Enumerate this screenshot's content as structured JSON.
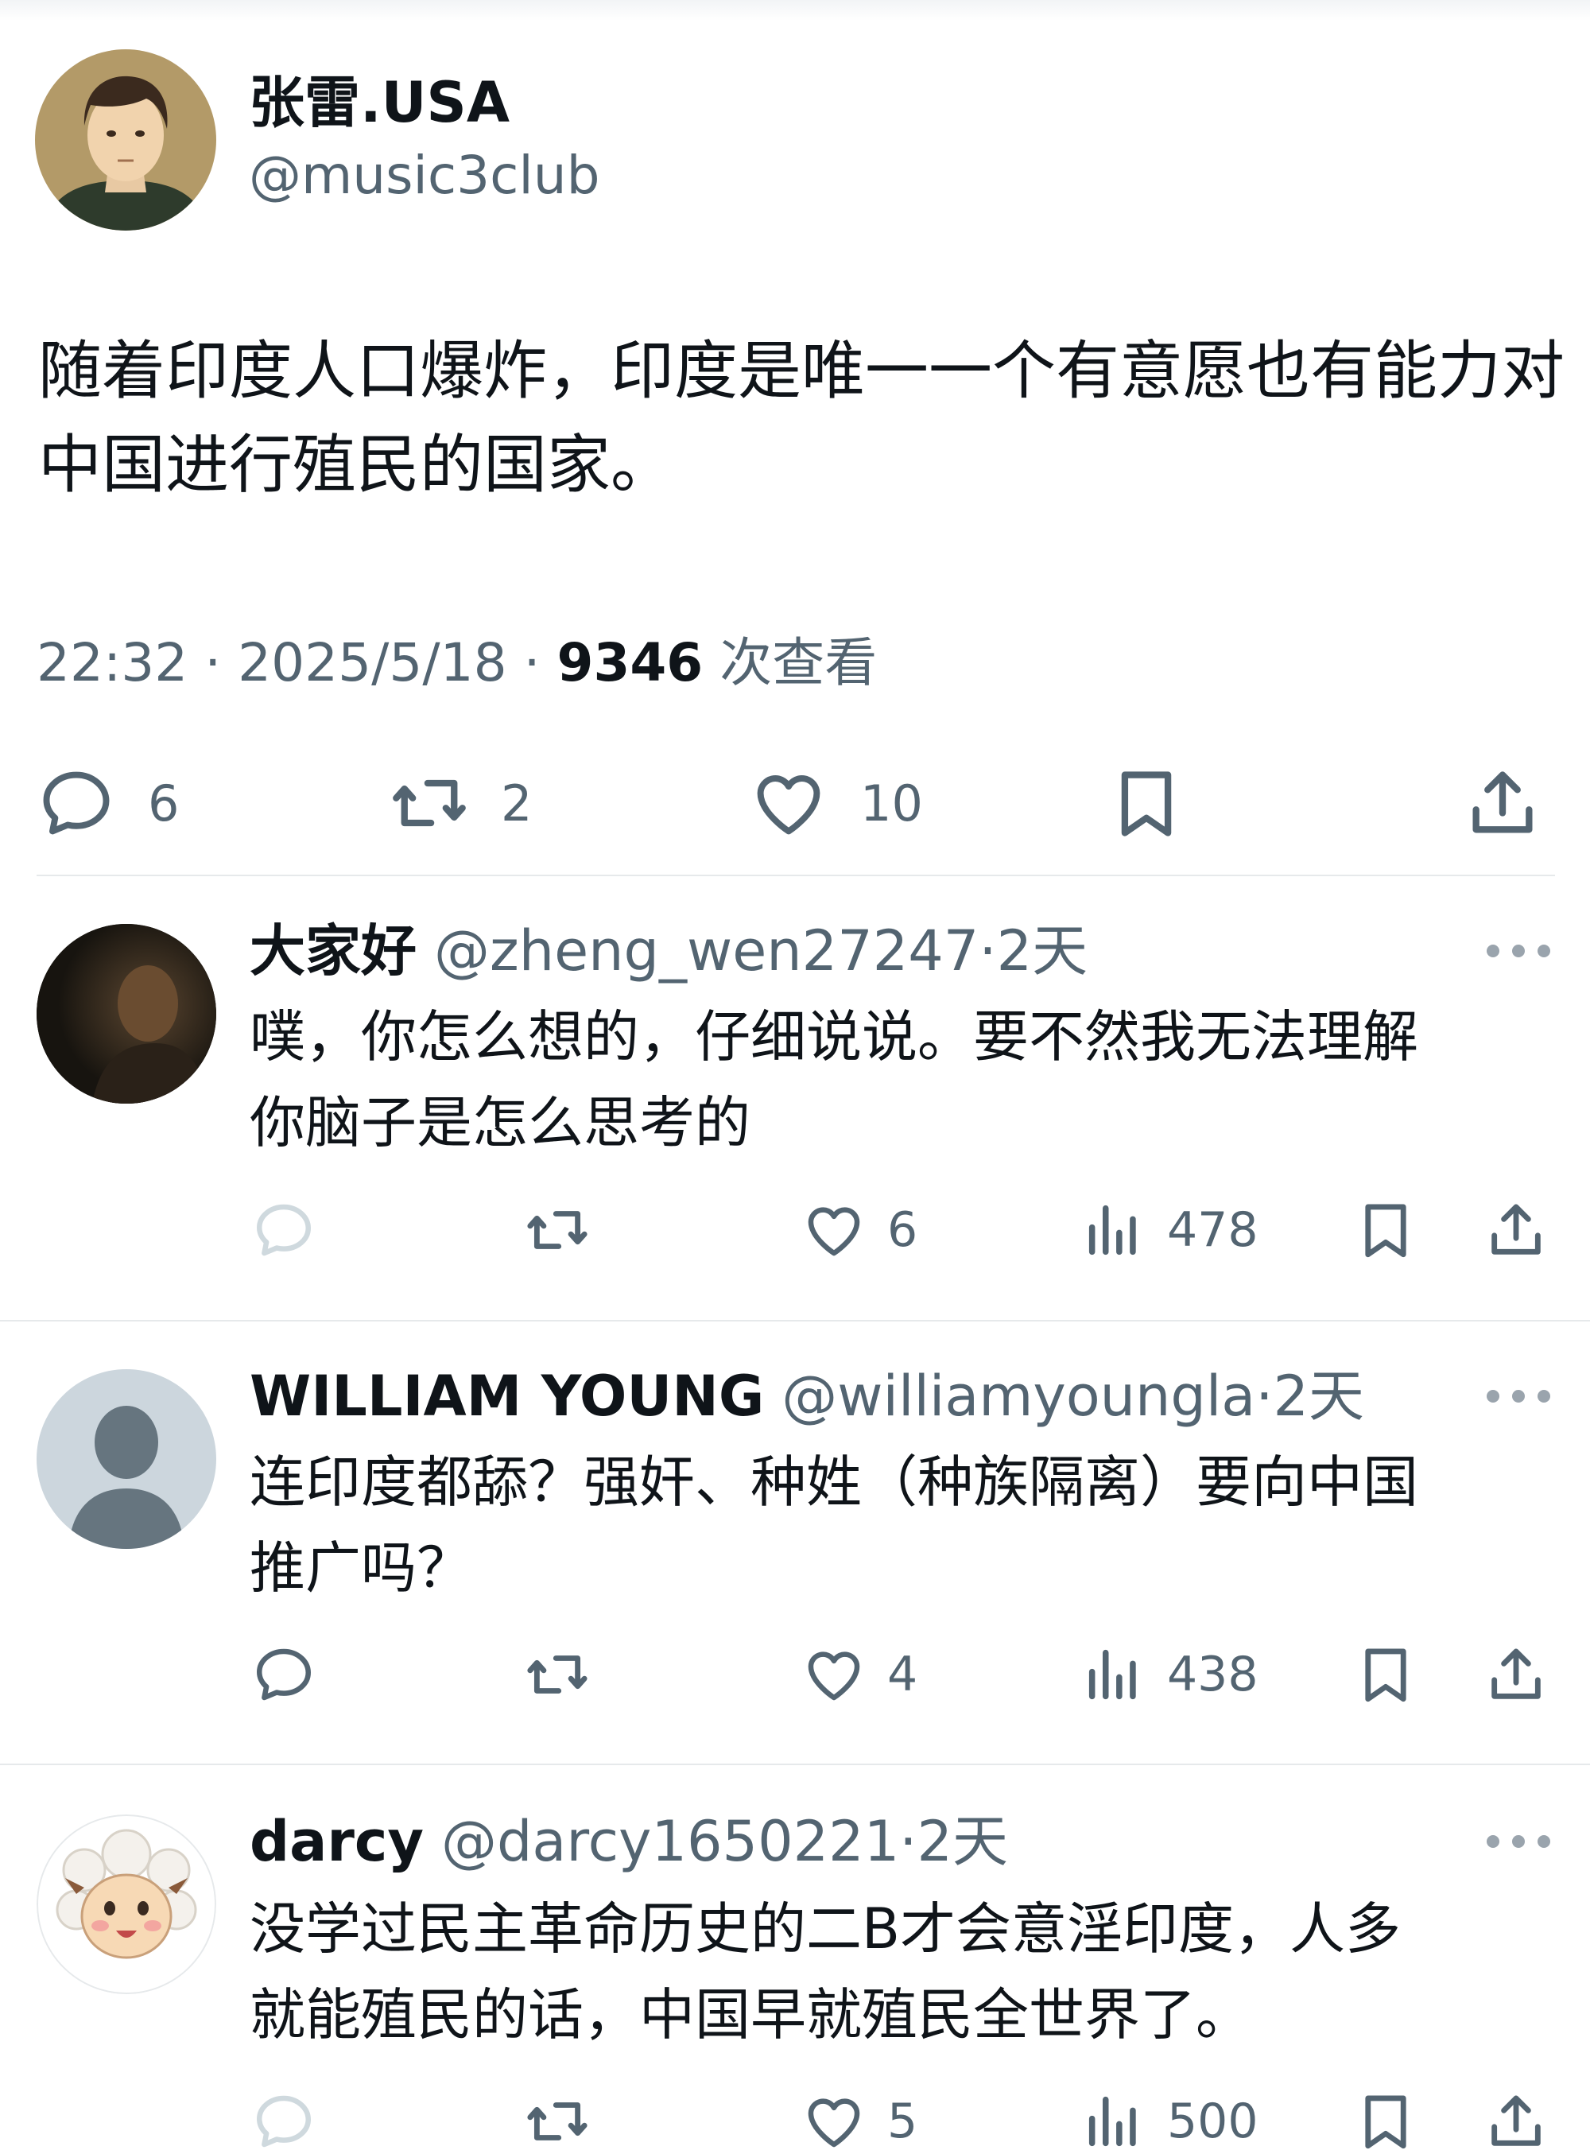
{
  "main_tweet": {
    "author_name": "张雷.USA",
    "author_handle": "@music3club",
    "text": "随着印度人口爆炸，印度是唯一一个有意愿也有能力对中国进行殖民的国家。",
    "time": "22:32",
    "date": "2025/5/18",
    "views": "9346",
    "views_label": "次查看",
    "separator": "·",
    "replies": "6",
    "retweets": "2",
    "likes": "10"
  },
  "replies": [
    {
      "name": "大家好",
      "handle": "@zheng_wen27247",
      "separator": "·",
      "time": "2天",
      "text_line1": "噗，你怎么想的，仔细说说。要不然我无法理解",
      "text_line2": "你脑子是怎么思考的",
      "likes": "6",
      "views": "478",
      "avatar": "dark-photo-avatar"
    },
    {
      "name": "WILLIAM YOUNG",
      "handle": "@williamyoungla",
      "separator": "·",
      "time": "2天",
      "text_line1": "连印度都舔？强奸、种姓（种族隔离）要向中国",
      "text_line2": "推广吗？",
      "likes": "4",
      "views": "438",
      "avatar": "default-profile-avatar"
    },
    {
      "name": "darcy",
      "handle": "@darcy1650221",
      "separator": "·",
      "time": "2天",
      "text_line1": "没学过民主革命历史的二B才会意淫印度，人多",
      "text_line2": "就能殖民的话，中国早就殖民全世界了。",
      "likes": "5",
      "views": "500",
      "avatar": "sheep-cartoon-avatar"
    }
  ],
  "icons": {
    "reply": "reply-bubble-icon",
    "retweet": "retweet-icon",
    "like": "heart-icon",
    "views": "views-chart-icon",
    "bookmark": "bookmark-icon",
    "share": "share-icon",
    "more": "more-dots-icon"
  },
  "colors": {
    "text": "#0f1419",
    "secondary": "#536471",
    "divider": "#e6e9eb",
    "icon_faded": "#cfd9de"
  }
}
